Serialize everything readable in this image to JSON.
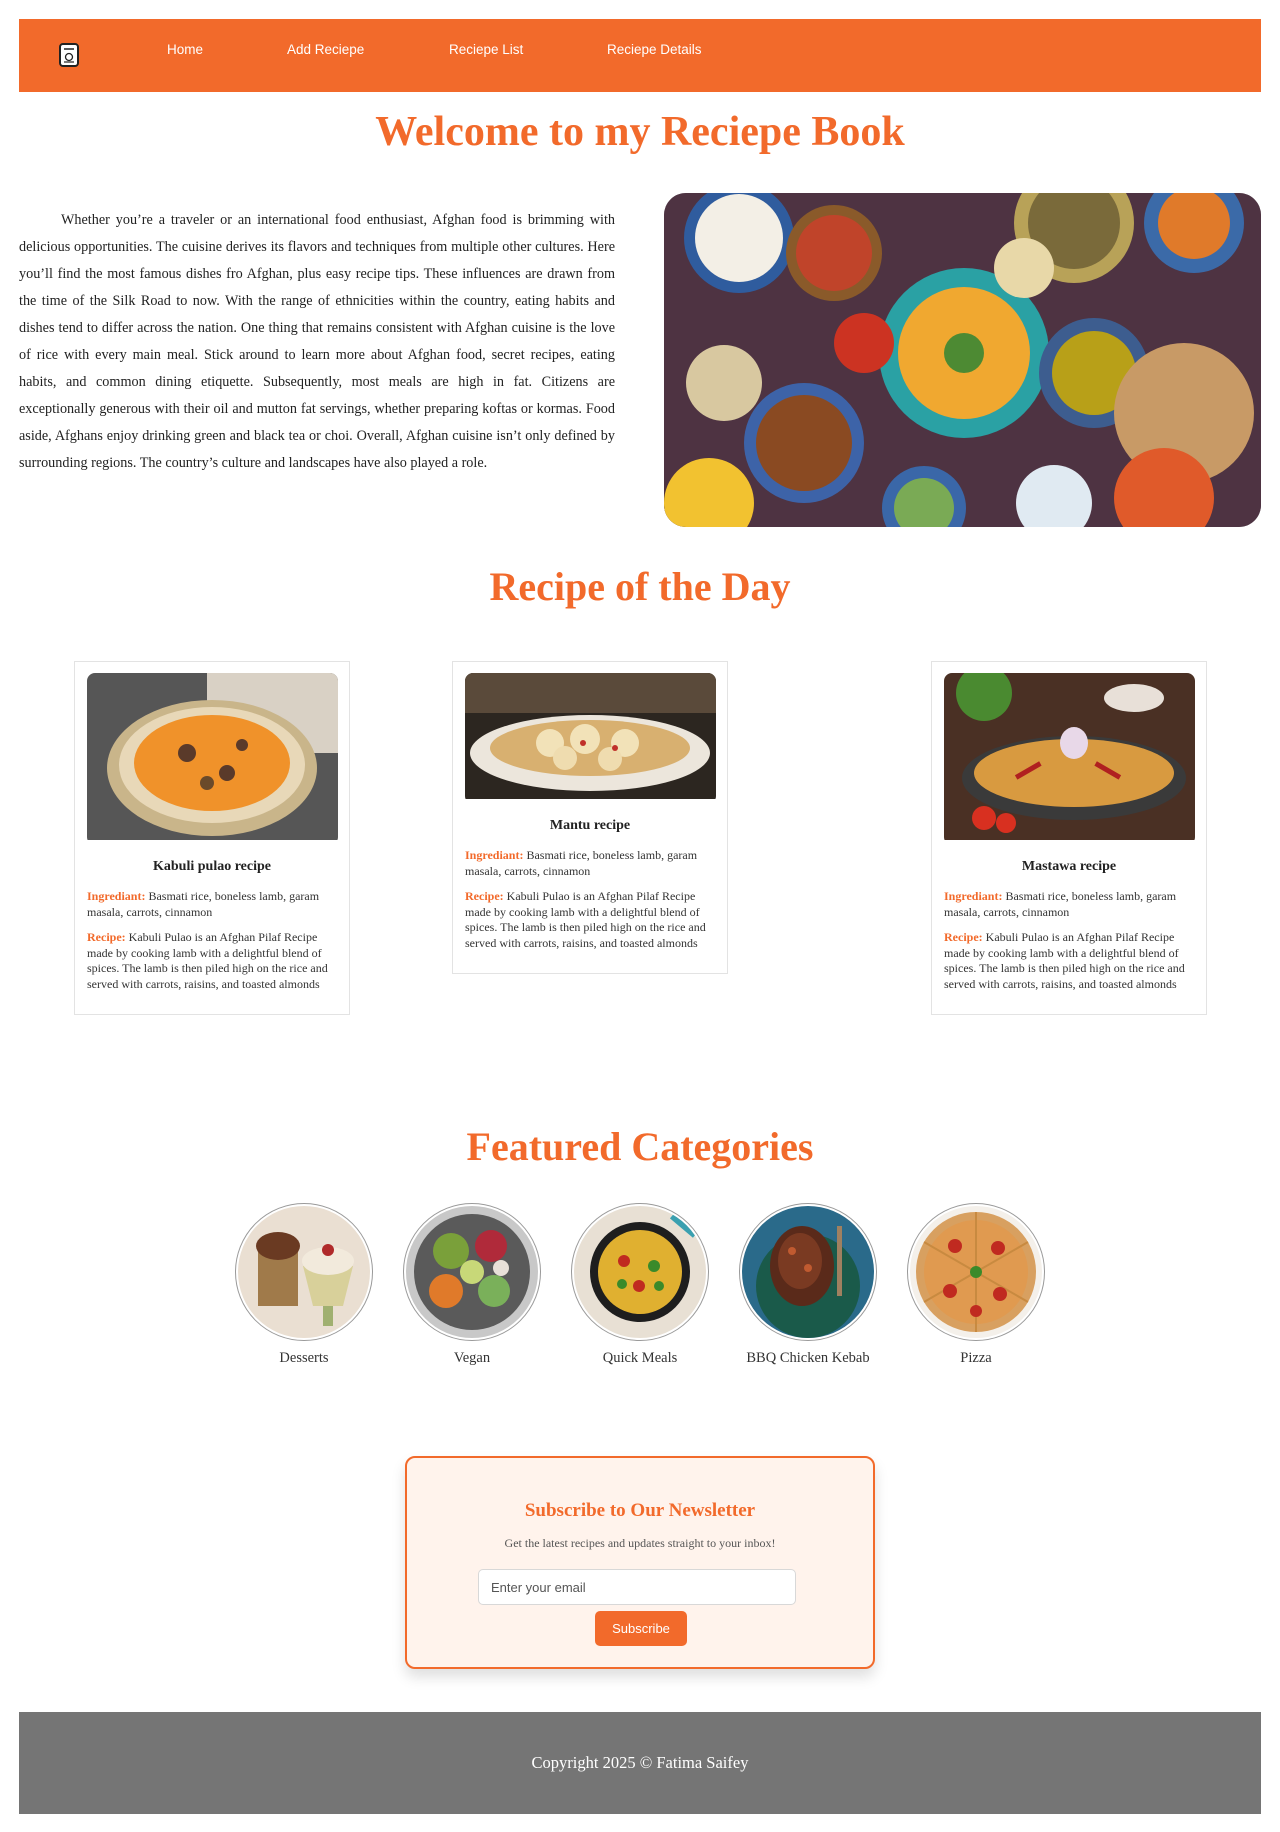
{
  "nav": {
    "logo_icon": "recipe-book-icon",
    "items": [
      {
        "label": "Home"
      },
      {
        "label": "Add Reciepe"
      },
      {
        "label": "Reciepe List"
      },
      {
        "label": "Reciepe Details"
      }
    ]
  },
  "welcome": {
    "title": "Welcome to my Reciepe Book",
    "intro": "Whether you’re a traveler or an international food enthusiast, Afghan food is brimming with delicious opportunities. The cuisine derives its flavors and techniques from multiple other cultures. Here you’ll find the most famous dishes fro Afghan, plus easy recipe tips. These influences are drawn from the time of the Silk Road to now. With the range of ethnicities within the country, eating habits and dishes tend to differ across the nation. One thing that remains consistent with Afghan cuisine is the love of rice with every main meal. Stick around to learn more about Afghan food, secret recipes, eating habits, and common dining etiquette. Subsequently, most meals are high in fat. Citizens are exceptionally generous with their oil and mutton fat servings, whether preparing koftas or kormas. Food aside, Afghans enjoy drinking green and black tea or choi. Overall, Afghan cuisine isn’t only defined by surrounding regions. The country’s culture and landscapes have also played a role."
  },
  "recipe_of_day": {
    "title": "Recipe of the Day",
    "cards": [
      {
        "name": "Kabuli pulao recipe",
        "ingredient_label": "Ingrediant:",
        "ingredient_text": " Basmati rice, boneless lamb, garam masala, carrots, cinnamon",
        "recipe_label": "Recipe:",
        "recipe_text": " Kabuli Pulao is an Afghan Pilaf Recipe made by cooking lamb with a delightful blend of spices. The lamb is then piled high on the rice and served with carrots, raisins, and toasted almonds"
      },
      {
        "name": "Mantu recipe",
        "ingredient_label": "Ingrediant:",
        "ingredient_text": " Basmati rice, boneless lamb, garam masala, carrots, cinnamon",
        "recipe_label": "Recipe:",
        "recipe_text": " Kabuli Pulao is an Afghan Pilaf Recipe made by cooking lamb with a delightful blend of spices. The lamb is then piled high on the rice and served with carrots, raisins, and toasted almonds"
      },
      {
        "name": "Mastawa recipe",
        "ingredient_label": "Ingrediant:",
        "ingredient_text": " Basmati rice, boneless lamb, garam masala, carrots, cinnamon",
        "recipe_label": "Recipe:",
        "recipe_text": " Kabuli Pulao is an Afghan Pilaf Recipe made by cooking lamb with a delightful blend of spices. The lamb is then piled high on the rice and served with carrots, raisins, and toasted almonds"
      }
    ]
  },
  "categories": {
    "title": "Featured Categories",
    "items": [
      {
        "label": "Desserts"
      },
      {
        "label": "Vegan"
      },
      {
        "label": "Quick Meals"
      },
      {
        "label": "BBQ Chicken Kebab"
      },
      {
        "label": "Pizza"
      }
    ]
  },
  "newsletter": {
    "title": "Subscribe to Our Newsletter",
    "subtitle": "Get the latest recipes and updates straight to your inbox!",
    "email_placeholder": "Enter your email",
    "button_label": "Subscribe"
  },
  "footer": {
    "copyright": "Copyright 2025 © Fatima Saifey"
  },
  "colors": {
    "accent": "#f26a2b",
    "footer_bg": "#757575",
    "newsletter_bg": "#fff3ec"
  }
}
